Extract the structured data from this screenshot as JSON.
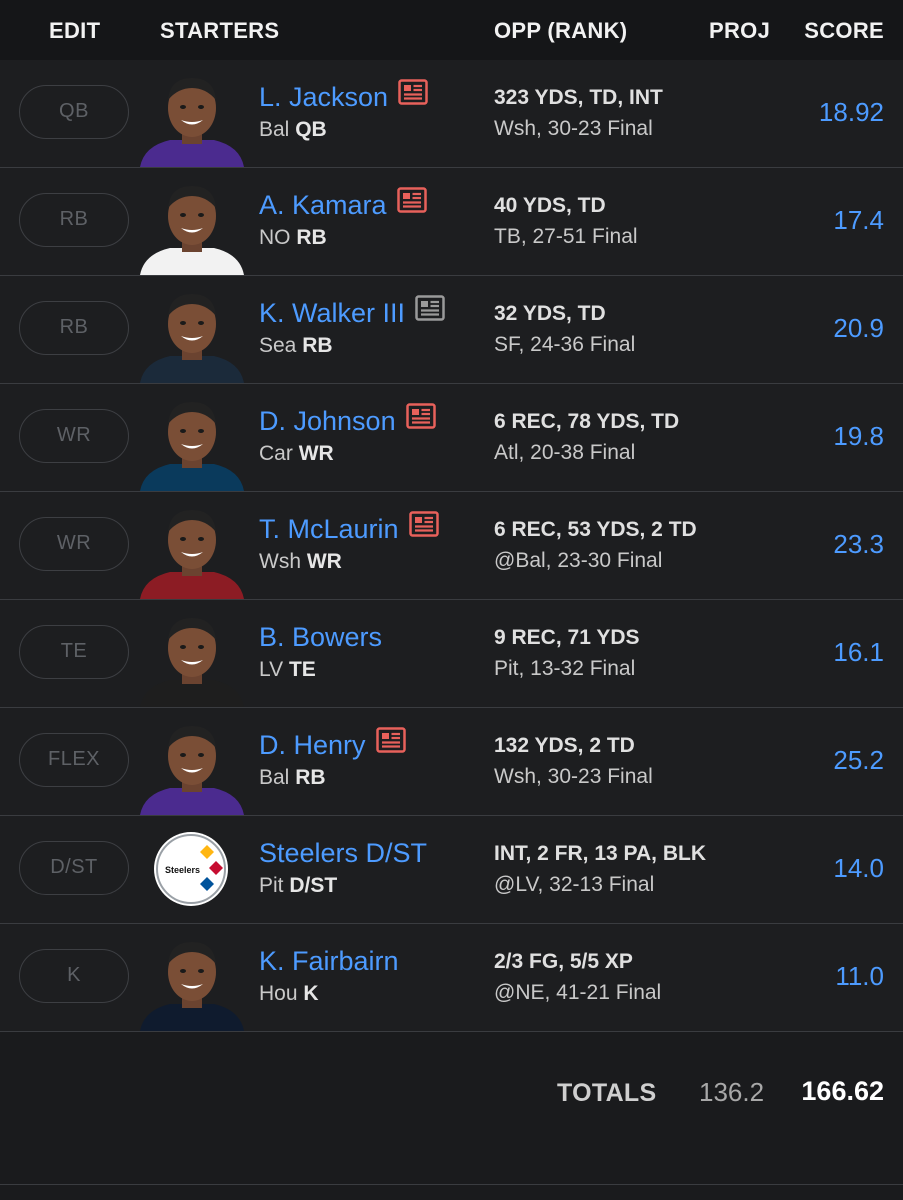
{
  "header": {
    "edit": "EDIT",
    "starters": "STARTERS",
    "opp": "OPP (RANK)",
    "proj": "PROJ",
    "score": "SCORE"
  },
  "players": [
    {
      "slot": "QB",
      "name": "L. Jackson",
      "team": "Bal",
      "pos": "QB",
      "stats": "323 YDS, TD, INT",
      "result": "Wsh, 30-23 Final",
      "score": "18.92",
      "news_icon": "news-icon-red",
      "jersey_color": "#4b2b8f"
    },
    {
      "slot": "RB",
      "name": "A. Kamara",
      "team": "NO",
      "pos": "RB",
      "stats": "40 YDS, TD",
      "result": "TB, 27-51 Final",
      "score": "17.4",
      "news_icon": "news-icon-red",
      "jersey_color": "#f2f2f2"
    },
    {
      "slot": "RB",
      "name": "K. Walker III",
      "team": "Sea",
      "pos": "RB",
      "stats": "32 YDS, TD",
      "result": "SF, 24-36 Final",
      "score": "20.9",
      "news_icon": "news-icon-gray",
      "jersey_color": "#1b2a3a"
    },
    {
      "slot": "WR",
      "name": "D. Johnson",
      "team": "Car",
      "pos": "WR",
      "stats": "6 REC, 78 YDS, TD",
      "result": "Atl, 20-38 Final",
      "score": "19.8",
      "news_icon": "news-icon-red",
      "jersey_color": "#0a3a5c"
    },
    {
      "slot": "WR",
      "name": "T. McLaurin",
      "team": "Wsh",
      "pos": "WR",
      "stats": "6 REC, 53 YDS, 2 TD",
      "result": "@Bal, 23-30 Final",
      "score": "23.3",
      "news_icon": "news-icon-red",
      "jersey_color": "#8c1c24"
    },
    {
      "slot": "TE",
      "name": "B. Bowers",
      "team": "LV",
      "pos": "TE",
      "stats": "9 REC, 71 YDS",
      "result": "Pit, 13-32 Final",
      "score": "16.1",
      "news_icon": "",
      "jersey_color": "#1e1e1e"
    },
    {
      "slot": "FLEX",
      "name": "D. Henry",
      "team": "Bal",
      "pos": "RB",
      "stats": "132 YDS, 2 TD",
      "result": "Wsh, 30-23 Final",
      "score": "25.2",
      "news_icon": "news-icon-red",
      "jersey_color": "#4b2b8f"
    },
    {
      "slot": "D/ST",
      "name": "Steelers D/ST",
      "team": "Pit",
      "pos": "D/ST",
      "stats": "INT, 2 FR, 13 PA, BLK",
      "result": "@LV, 32-13 Final",
      "score": "14.0",
      "news_icon": "",
      "logo": "steelers-logo",
      "logo_text": "Steelers"
    },
    {
      "slot": "K",
      "name": "K. Fairbairn",
      "team": "Hou",
      "pos": "K",
      "stats": "2/3 FG, 5/5 XP",
      "result": "@NE, 41-21 Final",
      "score": "11.0",
      "news_icon": "",
      "jersey_color": "#0f1b2e"
    }
  ],
  "totals": {
    "label": "TOTALS",
    "proj": "136.2",
    "score": "166.62"
  },
  "colors": {
    "accent": "#4d9bff",
    "news_red": "#e8615b",
    "news_gray": "#9a9a9a",
    "background": "#1d1e20"
  }
}
